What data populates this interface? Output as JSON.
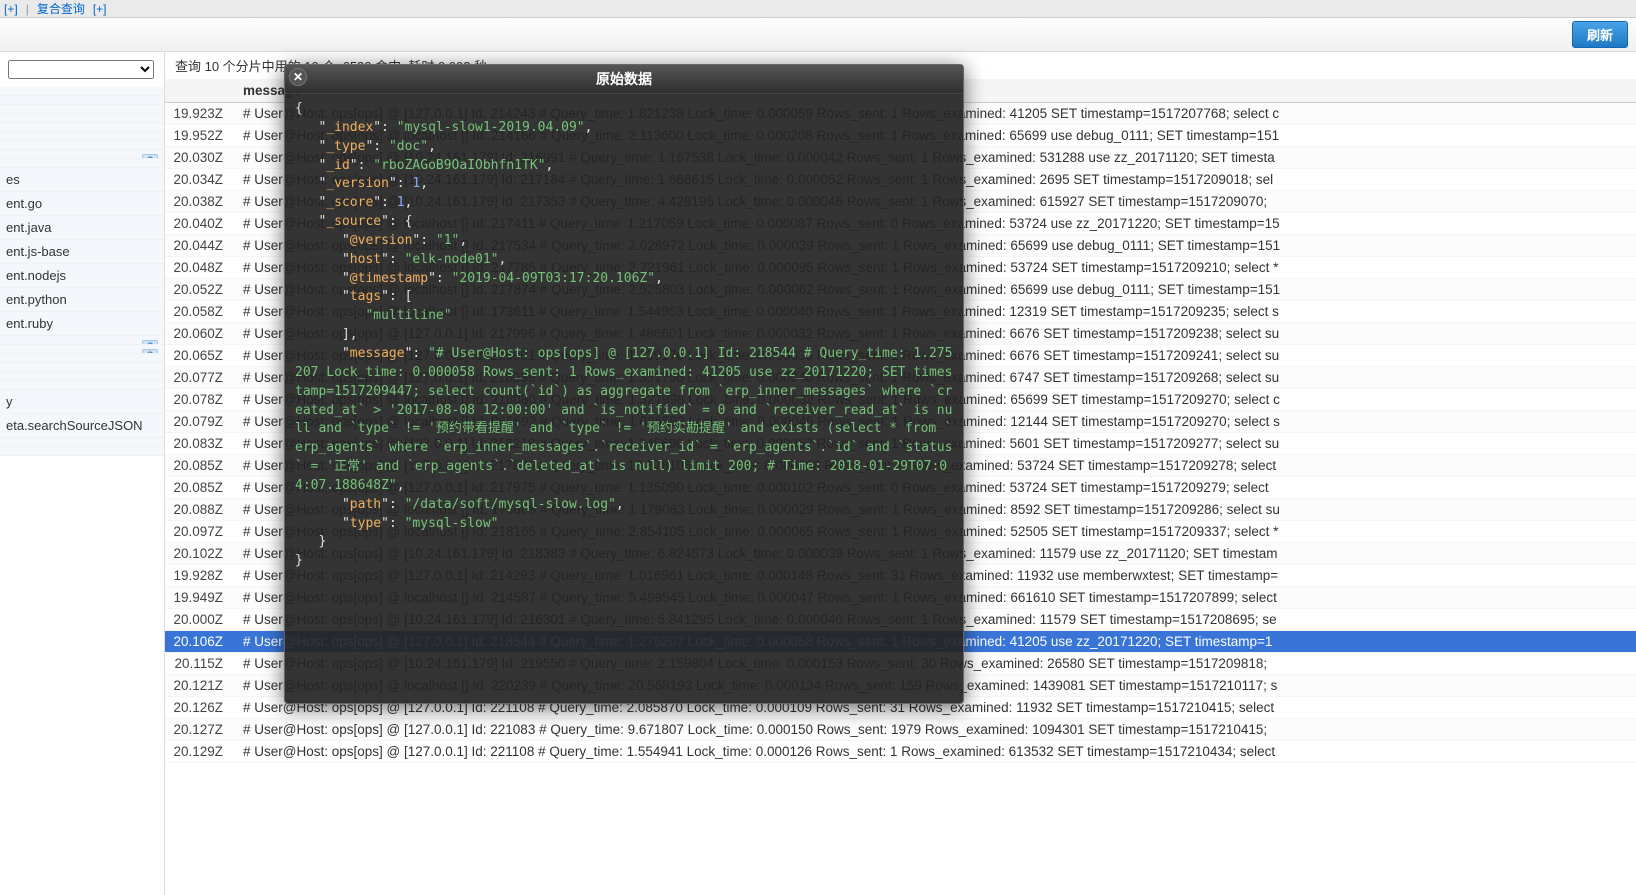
{
  "toolbar": {
    "btn_plus1": "[+]",
    "tab_compound": "复合查询",
    "btn_plus2": "[+]"
  },
  "refresh_label": "刷新",
  "sidebar": {
    "dropdown_placeholder": "",
    "items": [
      {
        "label": "",
        "q": false
      },
      {
        "label": "",
        "q": false
      },
      {
        "label": "",
        "q": false
      },
      {
        "label": "",
        "q": false
      },
      {
        "label": "",
        "q": false
      },
      {
        "label": "",
        "q": false
      },
      {
        "label": "",
        "q": false
      },
      {
        "label": "",
        "q": true
      },
      {
        "label": "",
        "q": false
      },
      {
        "label": "es",
        "q": false
      },
      {
        "label": "ent.go",
        "q": false
      },
      {
        "label": "ent.java",
        "q": false
      },
      {
        "label": "ent.js-base",
        "q": false
      },
      {
        "label": "ent.nodejs",
        "q": false
      },
      {
        "label": "ent.python",
        "q": false
      },
      {
        "label": "ent.ruby",
        "q": false
      },
      {
        "label": "",
        "q": true
      },
      {
        "label": "",
        "q": true
      },
      {
        "label": "",
        "q": false
      },
      {
        "label": "",
        "q": false
      },
      {
        "label": "",
        "q": false
      },
      {
        "label": "",
        "q": false
      },
      {
        "label": "y",
        "q": false
      },
      {
        "label": "eta.searchSourceJSON",
        "q": false
      },
      {
        "label": "",
        "q": false
      },
      {
        "label": "",
        "q": false
      }
    ]
  },
  "summary": "查询 10 个分片中用的 10 个. 6530 命中. 耗时 0.002 秒",
  "columns": {
    "c0": "",
    "c1": "message"
  },
  "rows": [
    {
      "t": "19.923Z",
      "m": "# User@Host: ops[ops] @ [127.0.0.1] Id: 214243 # Query_time: 1.821238 Lock_time: 0.000059 Rows_sent: 1 Rows_examined: 41205 SET timestamp=1517207768; select c"
    },
    {
      "t": "19.952Z",
      "m": "# User@Host: ops[ops] @ localhost [] Id: 214166 # Query_time: 2.113600 Lock_time: 0.000208 Rows_sent: 1 Rows_examined: 65699 use debug_0111; SET timestamp=151"
    },
    {
      "t": "20.030Z",
      "m": "# User@Host: ops[ops] @ [10.24.161.179] Id: 216991 # Query_time: 1.167538 Lock_time: 0.000042 Rows_sent: 1 Rows_examined: 531288 use zz_20171120; SET timesta"
    },
    {
      "t": "20.034Z",
      "m": "# User@Host: ops[ops] @ [10.24.161.179] Id: 217184 # Query_time: 1.668615 Lock_time: 0.000052 Rows_sent: 1 Rows_examined: 2695 SET timestamp=1517209018; sel"
    },
    {
      "t": "20.038Z",
      "m": "# User@Host: ops[ops] @ [10.24.161.179] Id: 217353 # Query_time: 4.428195 Lock_time: 0.000046 Rows_sent: 1 Rows_examined: 615927 SET timestamp=1517209070;"
    },
    {
      "t": "20.040Z",
      "m": "# User@Host: ops[ops] @ localhost [] Id: 217411 # Query_time: 1.217059 Lock_time: 0.000087 Rows_sent: 0 Rows_examined: 53724 use zz_20171220; SET timestamp=15"
    },
    {
      "t": "20.044Z",
      "m": "# User@Host: ops[ops] @ localhost [] Id: 217534 # Query_time: 2.028972 Lock_time: 0.000039 Rows_sent: 1 Rows_examined: 65699 use debug_0111; SET timestamp=151"
    },
    {
      "t": "20.048Z",
      "m": "# User@Host: ops[ops] @ localhost [] Id: 217785 # Query_time: 2.721961 Lock_time: 0.000095 Rows_sent: 1 Rows_examined: 53724 SET timestamp=1517209210; select *"
    },
    {
      "t": "20.052Z",
      "m": "# User@Host: ops[ops] @ localhost [] Id: 217874 # Query_time: 2.525803 Lock_time: 0.000062 Rows_sent: 1 Rows_examined: 65699 use debug_0111; SET timestamp=151"
    },
    {
      "t": "20.058Z",
      "m": "# User@Host: ops[ops] @ localhost [] Id: 173611 # Query_time: 1.544953 Lock_time: 0.000040 Rows_sent: 1 Rows_examined: 12319 SET timestamp=1517209235; select s"
    },
    {
      "t": "20.060Z",
      "m": "# User@Host: ops[ops] @ [127.0.0.1] Id: 217996 # Query_time: 1.486601 Lock_time: 0.000032 Rows_sent: 1 Rows_examined: 6676 SET timestamp=1517209238; select su"
    },
    {
      "t": "20.065Z",
      "m": "# User@Host: ops[ops] @ [127.0.0.1] Id: 218001 # Query_time: 1.339176 Lock_time: 0.000035 Rows_sent: 1 Rows_examined: 6676 SET timestamp=1517209241; select su"
    },
    {
      "t": "20.077Z",
      "m": "# User@Host: ops[ops] @ [127.0.0.1] Id: 218039 # Query_time: 1.351796 Lock_time: 0.000040 Rows_sent: 1 Rows_examined: 6747 SET timestamp=1517209268; select su"
    },
    {
      "t": "20.078Z",
      "m": "# User@Host: ops[ops] @ localhost [] Id: 218080 # Query_time: 1.327998 Lock_time: 0.000032 Rows_sent: 1 Rows_examined: 65699 SET timestamp=1517209270; select c"
    },
    {
      "t": "20.079Z",
      "m": "# User@Host: ops[ops] @ localhost [] Id: 065592 # Query_time: 1.065592 Lock_time: 0.000045 Rows_sent: 1 Rows_examined: 12144 SET timestamp=1517209270; select s"
    },
    {
      "t": "20.083Z",
      "m": "# User@Host: ops[ops] @ [127.0.0.1] Id: 218218 # Query_time: 1.145690 Lock_time: 0.000057 Rows_sent: 1 Rows_examined: 5601 SET timestamp=1517209277; select su"
    },
    {
      "t": "20.085Z",
      "m": "# User@Host: ops[ops] @ [127.0.0.1] Id: 217975 # Query_time: 13.878108 Lock_time: 0.000098 Rows_sent: 0 Rows_examined: 53724 SET timestamp=1517209278; select"
    },
    {
      "t": "20.085Z",
      "m": "# User@Host: ops[ops] @ [127.0.0.1] Id: 217975 # Query_time: 1.135090 Lock_time: 0.000102 Rows_sent: 0 Rows_examined: 53724 SET timestamp=1517209279; select"
    },
    {
      "t": "20.088Z",
      "m": "# User@Host: ops[ops] @ localhost [] Id: 173608 # Query_time: 1.179063 Lock_time: 0.000029 Rows_sent: 1 Rows_examined: 8592 SET timestamp=1517209286; select su"
    },
    {
      "t": "20.097Z",
      "m": "# User@Host: ops[ops] @ localhost [] Id: 218165 # Query_time: 2.854105 Lock_time: 0.000065 Rows_sent: 1 Rows_examined: 52505 SET timestamp=1517209337; select *"
    },
    {
      "t": "20.102Z",
      "m": "# User@Host: ops[ops] @ [10.24.161.179] Id: 218383 # Query_time: 6.824573 Lock_time: 0.000039 Rows_sent: 1 Rows_examined: 11579 use zz_20171120; SET timestam"
    },
    {
      "t": "19.928Z",
      "m": "# User@Host: ops[ops] @ [127.0.0.1] Id: 214293 # Query_time: 1.016961 Lock_time: 0.000148 Rows_sent: 31 Rows_examined: 11932 use memberwxtest; SET timestamp="
    },
    {
      "t": "19.949Z",
      "m": "# User@Host: ops[ops] @ localhost [] Id: 214587 # Query_time: 5.499545 Lock_time: 0.000047 Rows_sent: 1 Rows_examined: 661610 SET timestamp=1517207899; select"
    },
    {
      "t": "20.000Z",
      "m": "# User@Host: ops[ops] @ [10.24.161.179] Id: 216301 # Query_time: 5.841295 Lock_time: 0.000040 Rows_sent: 1 Rows_examined: 11579 SET timestamp=1517208695; se"
    },
    {
      "t": "20.106Z",
      "m": "# User@Host: ops[ops] @ [127.0.0.1] Id: 218544 # Query_time: 1.275207 Lock_time: 0.000058 Rows_sent: 1 Rows_examined: 41205 use zz_20171220; SET timestamp=1"
    },
    {
      "t": "20.115Z",
      "m": "# User@Host: ops[ops] @ [10.24.161.179] Id: 219550 # Query_time: 2.159804 Lock_time: 0.000153 Rows_sent: 30 Rows_examined: 26580 SET timestamp=1517209818;"
    },
    {
      "t": "20.121Z",
      "m": "# User@Host: ops[ops] @ localhost [] Id: 220239 # Query_time: 20.568193 Lock_time: 0.000134 Rows_sent: 159 Rows_examined: 1439081 SET timestamp=1517210117; s"
    },
    {
      "t": "20.126Z",
      "m": "# User@Host: ops[ops] @ [127.0.0.1] Id: 221108 # Query_time: 2.085870 Lock_time: 0.000109 Rows_sent: 31 Rows_examined: 11932 SET timestamp=1517210415; select"
    },
    {
      "t": "20.127Z",
      "m": "# User@Host: ops[ops] @ [127.0.0.1] Id: 221083 # Query_time: 9.671807 Lock_time: 0.000150 Rows_sent: 1979 Rows_examined: 1094301 SET timestamp=1517210415;"
    },
    {
      "t": "20.129Z",
      "m": "# User@Host: ops[ops] @ [127.0.0.1] Id: 221108 # Query_time: 1.554941 Lock_time: 0.000126 Rows_sent: 1 Rows_examined: 613532 SET timestamp=1517210434; select"
    }
  ],
  "selected_row_index": 24,
  "modal": {
    "title": "原始数据",
    "json": {
      "_index": "mysql-slow1-2019.04.09",
      "_type": "doc",
      "_id": "rboZAGoB9OaIObhfn1TK",
      "_version": 1,
      "_score": 1,
      "_source": {
        "@version": "1",
        "host": "elk-node01",
        "@timestamp": "2019-04-09T03:17:20.106Z",
        "tags": [
          "multiline"
        ],
        "message": "# User@Host: ops[ops] @ [127.0.0.1] Id: 218544 # Query_time: 1.275207 Lock_time: 0.000058 Rows_sent: 1 Rows_examined: 41205 use zz_20171220; SET timestamp=1517209447; select count(`id`) as aggregate from `erp_inner_messages` where `created_at` > '2017-08-08 12:00:00' and `is_notified` = 0 and `receiver_read_at` is null and `type` != '预约带看提醒' and `type` != '预约实勘提醒' and exists (select * from `erp_agents` where `erp_inner_messages`.`receiver_id` = `erp_agents`.`id` and `status` = '正常' and `erp_agents`.`deleted_at` is null) limit 200; # Time: 2018-01-29T07:04:07.188648Z",
        "path": "/data/soft/mysql-slow.log",
        "type": "mysql-slow"
      }
    }
  }
}
